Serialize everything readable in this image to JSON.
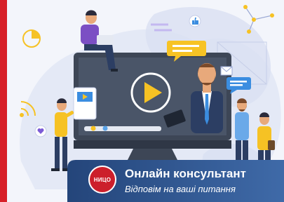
{
  "colors": {
    "accent_red": "#d71f28",
    "banner_blue": "#2c4f85",
    "banner_blue_light": "#3f6aa8",
    "logo_red": "#cc1f2b",
    "screen_dark": "#4a5568",
    "play_yellow": "#f6c224",
    "bubble_yellow": "#f7c325"
  },
  "banner": {
    "logo_text": "НИЦО",
    "title": "Онлайн консультант",
    "subtitle": "Відповім на ваші питання"
  },
  "icons": [
    "play-icon",
    "pie-chart-icon",
    "wifi-icon",
    "heart-icon",
    "like-icon",
    "chat-bubble-icon",
    "network-icon",
    "email-icon"
  ]
}
